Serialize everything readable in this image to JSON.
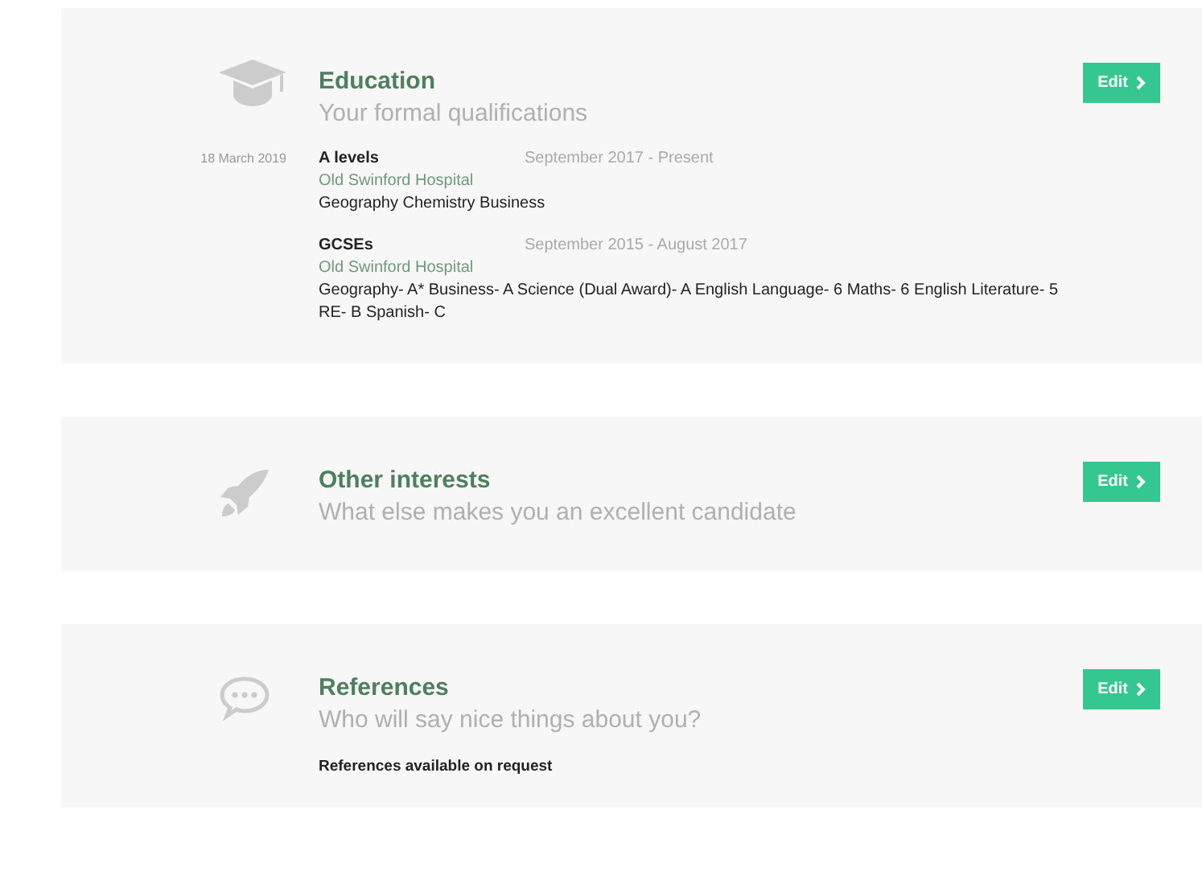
{
  "sections": [
    {
      "kind": "education",
      "title": "Education",
      "subtitle": "Your formal qualifications",
      "button": "Edit",
      "date": "18 March 2019",
      "entries": [
        {
          "title": "A levels",
          "dates": "September 2017 - Present",
          "school": "Old Swinford Hospital",
          "details": "Geography Chemistry Business"
        },
        {
          "title": "GCSEs",
          "dates": "September 2015 - August 2017",
          "school": "Old Swinford Hospital",
          "details": "Geography- A* Business- A Science (Dual Award)- A English Language- 6 Maths- 6 English Literature- 5 RE- B Spanish- C"
        }
      ]
    },
    {
      "kind": "interests",
      "title": "Other interests",
      "subtitle": "What else makes you an excellent candidate",
      "button": "Edit"
    },
    {
      "kind": "references",
      "title": "References",
      "subtitle": "Who will say nice things about you?",
      "button": "Edit",
      "note": "References available on request"
    }
  ]
}
